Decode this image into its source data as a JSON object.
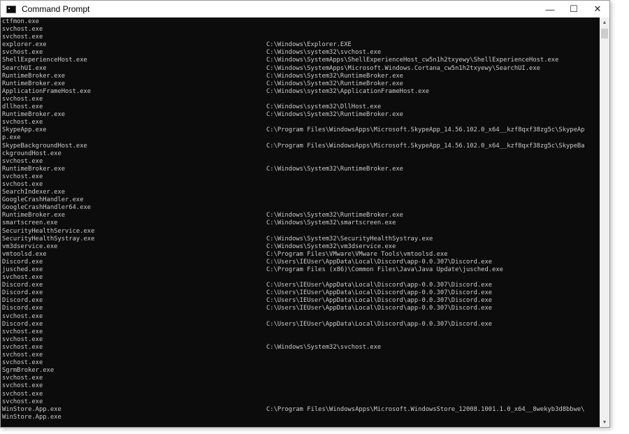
{
  "window": {
    "title": "Command Prompt"
  },
  "controls": {
    "minimize": "—",
    "maximize": "☐",
    "close": "✕"
  },
  "scrollbar": {
    "up": "▲",
    "down": "▼"
  },
  "rows": [
    [
      "ctfmon.exe",
      ""
    ],
    [
      "svchost.exe",
      ""
    ],
    [
      "svchost.exe",
      ""
    ],
    [
      "explorer.exe",
      "C:\\Windows\\Explorer.EXE"
    ],
    [
      "svchost.exe",
      "C:\\Windows\\system32\\svchost.exe"
    ],
    [
      "ShellExperienceHost.exe",
      "C:\\Windows\\SystemApps\\ShellExperienceHost_cw5n1h2txyewy\\ShellExperienceHost.exe"
    ],
    [
      "SearchUI.exe",
      "C:\\Windows\\SystemApps\\Microsoft.Windows.Cortana_cw5n1h2txyewy\\SearchUI.exe"
    ],
    [
      "RuntimeBroker.exe",
      "C:\\Windows\\System32\\RuntimeBroker.exe"
    ],
    [
      "RuntimeBroker.exe",
      "C:\\Windows\\System32\\RuntimeBroker.exe"
    ],
    [
      "ApplicationFrameHost.exe",
      "C:\\Windows\\system32\\ApplicationFrameHost.exe"
    ],
    [
      "svchost.exe",
      ""
    ],
    [
      "dllhost.exe",
      "C:\\Windows\\system32\\DllHost.exe"
    ],
    [
      "RuntimeBroker.exe",
      "C:\\Windows\\System32\\RuntimeBroker.exe"
    ],
    [
      "svchost.exe",
      ""
    ],
    [
      "SkypeApp.exe",
      "C:\\Program Files\\WindowsApps\\Microsoft.SkypeApp_14.56.102.0_x64__kzf8qxf38zg5c\\SkypeAp"
    ],
    [
      "p.exe",
      ""
    ],
    [
      "SkypeBackgroundHost.exe",
      "C:\\Program Files\\WindowsApps\\Microsoft.SkypeApp_14.56.102.0_x64__kzf8qxf38zg5c\\SkypeBa"
    ],
    [
      "ckgroundHost.exe",
      ""
    ],
    [
      "svchost.exe",
      ""
    ],
    [
      "RuntimeBroker.exe",
      "C:\\Windows\\System32\\RuntimeBroker.exe"
    ],
    [
      "svchost.exe",
      ""
    ],
    [
      "svchost.exe",
      ""
    ],
    [
      "SearchIndexer.exe",
      ""
    ],
    [
      "GoogleCrashHandler.exe",
      ""
    ],
    [
      "GoogleCrashHandler64.exe",
      ""
    ],
    [
      "RuntimeBroker.exe",
      "C:\\Windows\\System32\\RuntimeBroker.exe"
    ],
    [
      "smartscreen.exe",
      "C:\\Windows\\System32\\smartscreen.exe"
    ],
    [
      "SecurityHealthService.exe",
      ""
    ],
    [
      "SecurityHealthSystray.exe",
      "C:\\Windows\\System32\\SecurityHealthSystray.exe"
    ],
    [
      "vm3dservice.exe",
      "C:\\Windows\\System32\\vm3dservice.exe"
    ],
    [
      "vmtoolsd.exe",
      "C:\\Program Files\\VMware\\VMware Tools\\vmtoolsd.exe"
    ],
    [
      "Discord.exe",
      "C:\\Users\\IEUser\\AppData\\Local\\Discord\\app-0.0.307\\Discord.exe"
    ],
    [
      "jusched.exe",
      "C:\\Program Files (x86)\\Common Files\\Java\\Java Update\\jusched.exe"
    ],
    [
      "svchost.exe",
      ""
    ],
    [
      "Discord.exe",
      "C:\\Users\\IEUser\\AppData\\Local\\Discord\\app-0.0.307\\Discord.exe"
    ],
    [
      "Discord.exe",
      "C:\\Users\\IEUser\\AppData\\Local\\Discord\\app-0.0.307\\Discord.exe"
    ],
    [
      "Discord.exe",
      "C:\\Users\\IEUser\\AppData\\Local\\Discord\\app-0.0.307\\Discord.exe"
    ],
    [
      "Discord.exe",
      "C:\\Users\\IEUser\\AppData\\Local\\Discord\\app-0.0.307\\Discord.exe"
    ],
    [
      "svchost.exe",
      ""
    ],
    [
      "Discord.exe",
      "C:\\Users\\IEUser\\AppData\\Local\\Discord\\app-0.0.307\\Discord.exe"
    ],
    [
      "svchost.exe",
      ""
    ],
    [
      "svchost.exe",
      ""
    ],
    [
      "svchost.exe",
      "C:\\Windows\\System32\\svchost.exe"
    ],
    [
      "svchost.exe",
      ""
    ],
    [
      "svchost.exe",
      ""
    ],
    [
      "SgrmBroker.exe",
      ""
    ],
    [
      "svchost.exe",
      ""
    ],
    [
      "svchost.exe",
      ""
    ],
    [
      "svchost.exe",
      ""
    ],
    [
      "svchost.exe",
      ""
    ],
    [
      "WinStore.App.exe",
      "C:\\Program Files\\WindowsApps\\Microsoft.WindowsStore_12008.1001.1.0_x64__8wekyb3d8bbwe\\"
    ],
    [
      "WinStore.App.exe",
      ""
    ]
  ]
}
